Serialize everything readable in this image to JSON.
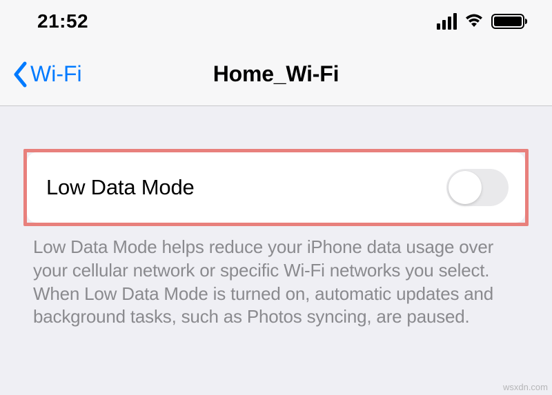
{
  "status": {
    "time": "21:52"
  },
  "nav": {
    "back_label": "Wi-Fi",
    "title": "Home_Wi-Fi"
  },
  "setting": {
    "label": "Low Data Mode",
    "enabled": false
  },
  "description": "Low Data Mode helps reduce your iPhone data usage over your cellular network or specific Wi-Fi networks you select. When Low Data Mode is turned on, automatic updates and background tasks, such as Photos syncing, are paused.",
  "watermark": "wsxdn.com"
}
